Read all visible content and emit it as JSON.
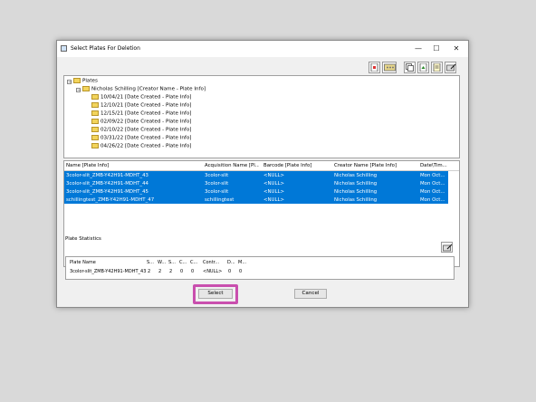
{
  "window": {
    "title": "Select Plates For Deletion",
    "minimize": "—",
    "maximize": "☐",
    "close": "✕"
  },
  "toolbar": {
    "buttons": [
      "add-plate-icon",
      "plate-view-icon",
      "copy-icon",
      "export-icon",
      "document-icon",
      "edit-icon"
    ]
  },
  "tree": {
    "root": "Plates",
    "creator": "Nicholas Schilling [Creator Name - Plate Info]",
    "dates": [
      "10/04/21 [Date Created - Plate Info]",
      "12/10/21 [Date Created - Plate Info]",
      "12/15/21 [Date Created - Plate Info]",
      "02/09/22 [Date Created - Plate Info]",
      "02/10/22 [Date Created - Plate Info]",
      "03/31/22 [Date Created - Plate Info]",
      "04/26/22 [Date Created - Plate Info]"
    ]
  },
  "grid": {
    "columns": [
      "Name [Plate Info]",
      "Acquisition Name [Pl...",
      "Barcode [Plate Info]",
      "Creator Name [Plate Info]",
      "Date\\Tim..."
    ],
    "rows": [
      [
        "3color-slit_ZMB-Y42H91-MDHT_43",
        "3color-slit",
        "<NULL>",
        "Nicholas Schilling",
        "Mon Oct..."
      ],
      [
        "3color-slit_ZMB-Y42H91-MDHT_44",
        "3color-slit",
        "<NULL>",
        "Nicholas Schilling",
        "Mon Oct..."
      ],
      [
        "3color-slit_ZMB-Y42H91-MDHT_45",
        "3color-slit",
        "<NULL>",
        "Nicholas Schilling",
        "Mon Oct..."
      ],
      [
        "schillingtest_ZMB-Y42H91-MDHT_47",
        "schillingtest",
        "<NULL>",
        "Nicholas Schilling",
        "Mon Oct..."
      ]
    ],
    "selection_color": "#0078d7"
  },
  "stats": {
    "label": "Plate Statistics",
    "columns": [
      "Plate Name",
      "S...",
      "W...",
      "S...",
      "C...",
      "C...",
      "Contr...",
      "D...",
      "M..."
    ],
    "values": [
      "3color-slit_ZMB-Y42H91-MDHT_43",
      "2",
      "2",
      "2",
      "0",
      "0",
      "<NULL>",
      "0",
      "0"
    ]
  },
  "buttons": {
    "select": "Select",
    "cancel": "Cancel"
  },
  "highlight_color": "#c94fae"
}
